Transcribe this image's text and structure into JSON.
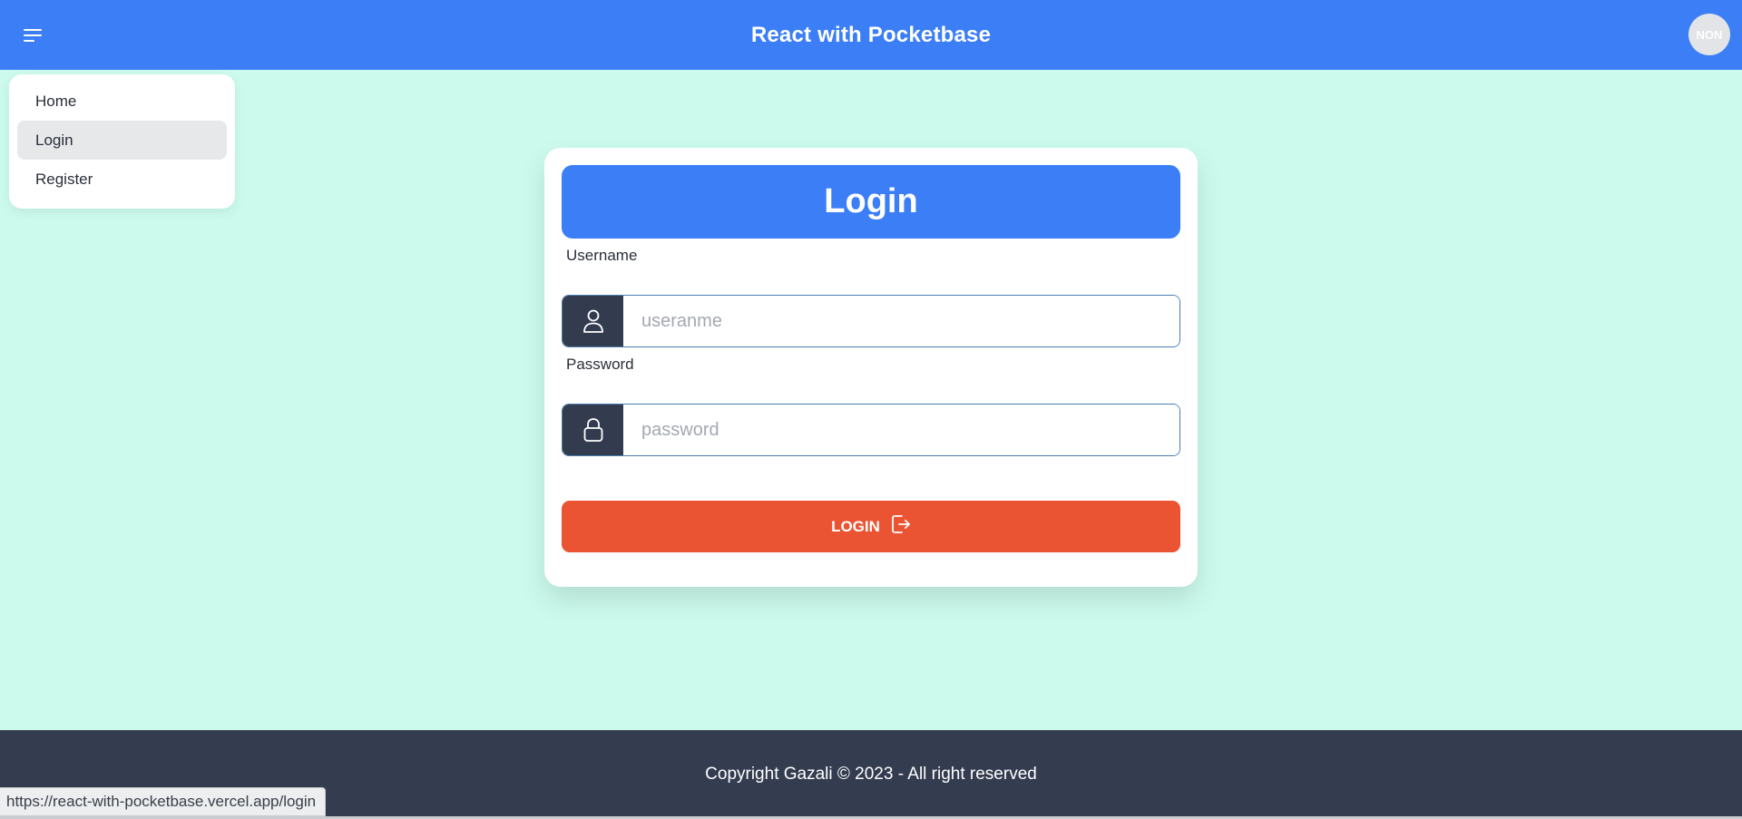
{
  "header": {
    "title": "React with Pocketbase",
    "avatar_text": "NON"
  },
  "menu": {
    "items": [
      {
        "label": "Home"
      },
      {
        "label": "Login"
      },
      {
        "label": "Register"
      }
    ],
    "active": "Login"
  },
  "login_card": {
    "title": "Login",
    "username": {
      "label": "Username",
      "placeholder": "useranme",
      "value": "",
      "icon": "user-icon"
    },
    "password": {
      "label": "Password",
      "placeholder": "password",
      "value": "",
      "icon": "lock-icon"
    },
    "submit_label": "LOGIN",
    "submit_icon": "sign-in-icon"
  },
  "footer": {
    "copyright": "Copyright Gazali © 2023 - All right reserved"
  },
  "status_bar": {
    "url": "https://react-with-pocketbase.vercel.app/login"
  },
  "colors": {
    "primary": "#3b7ef6",
    "background": "#ccfbee",
    "accent": "#eb5433",
    "dark": "#343c50"
  }
}
